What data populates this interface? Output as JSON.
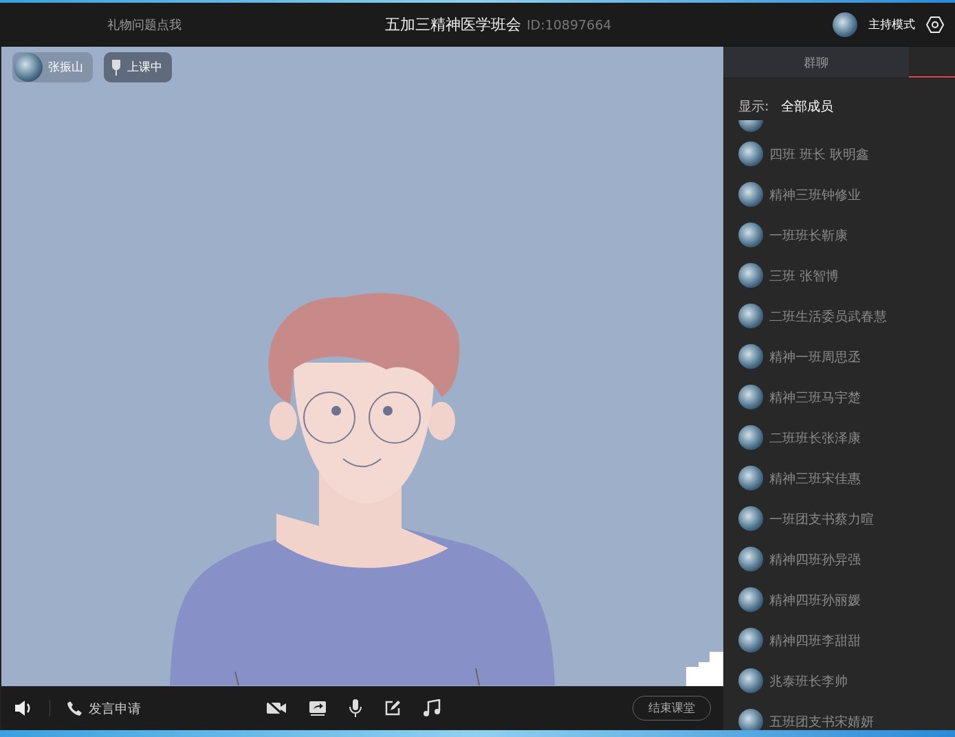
{
  "header": {
    "gift_link": "礼物问题点我",
    "title": "五加三精神医学班会",
    "room_id": "ID:10897664",
    "mode": "主持模式"
  },
  "video": {
    "speaker": "张振山",
    "status": "上课中"
  },
  "toolbar": {
    "request": "发言申请",
    "end_button": "结束课堂",
    "camera_off": true
  },
  "sidebar": {
    "tab": "群聊",
    "filter_label": "显示:",
    "filter_value": "全部成员",
    "members": [
      {
        "name": "四班 班长 耿明鑫"
      },
      {
        "name": "精神三班钟修业"
      },
      {
        "name": "一班班长靳康"
      },
      {
        "name": "三班 张智博"
      },
      {
        "name": "二班生活委员武春慧"
      },
      {
        "name": "精神一班周思丞"
      },
      {
        "name": "精神三班马宇楚"
      },
      {
        "name": "二班班长张泽康"
      },
      {
        "name": "精神三班宋佳惠"
      },
      {
        "name": "一班团支书蔡力暄"
      },
      {
        "name": "精神四班孙异强"
      },
      {
        "name": "精神四班孙丽媛"
      },
      {
        "name": "精神四班李甜甜"
      },
      {
        "name": "兆泰班长李帅"
      },
      {
        "name": "五班团支书宋婧妍"
      }
    ]
  }
}
